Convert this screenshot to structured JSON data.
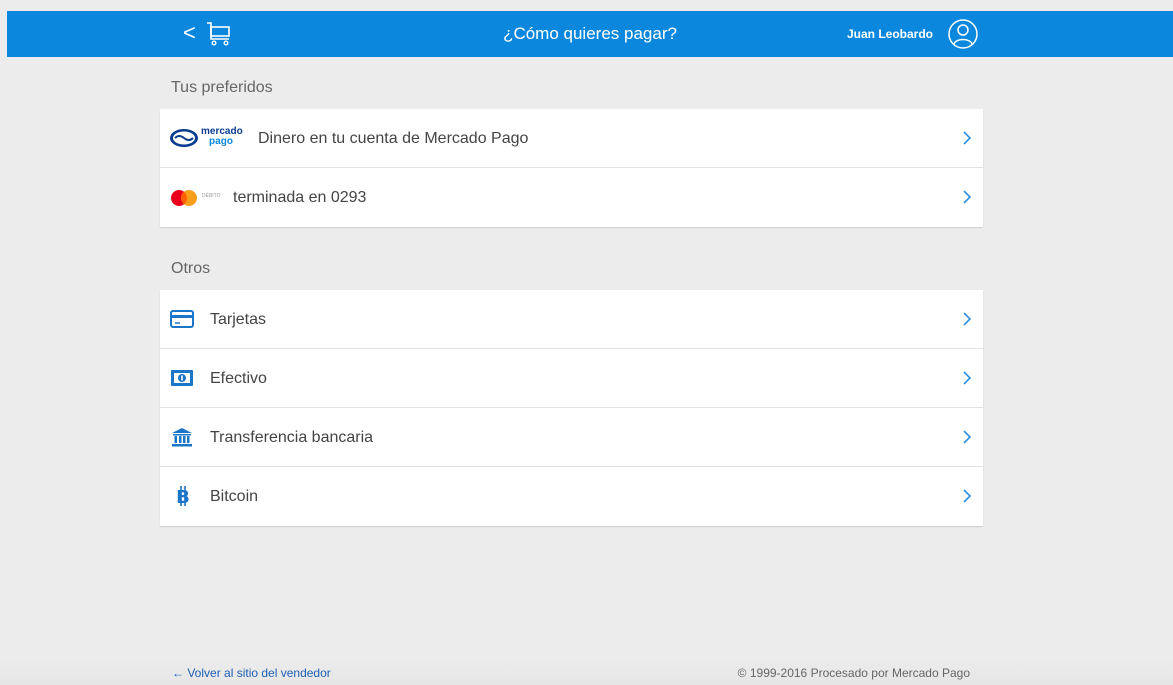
{
  "header": {
    "back_glyph": "<",
    "title": "¿Cómo quieres pagar?",
    "user_name": "Juan Leobardo"
  },
  "sections": {
    "preferred": {
      "title": "Tus preferidos",
      "items": [
        {
          "label": "Dinero en tu cuenta de Mercado Pago",
          "icon": "mercadopago-logo",
          "logo_text_top": "mercado",
          "logo_text_bottom": "pago"
        },
        {
          "label": "terminada en 0293",
          "icon": "mastercard-debit-logo",
          "logo_text": "DÉBITO"
        }
      ]
    },
    "others": {
      "title": "Otros",
      "items": [
        {
          "label": "Tarjetas",
          "icon": "credit-card-icon"
        },
        {
          "label": "Efectivo",
          "icon": "cash-icon"
        },
        {
          "label": "Transferencia bancaria",
          "icon": "bank-icon"
        },
        {
          "label": "Bitcoin",
          "icon": "bitcoin-icon"
        }
      ]
    }
  },
  "footer": {
    "back_link": "← Volver al sitio del vendedor",
    "copyright": "© 1999-2016 Procesado por Mercado Pago"
  },
  "colors": {
    "primary": "#0b87dd",
    "background": "#ececec",
    "chevron": "#2d8fe0",
    "link": "#1d5fb5"
  }
}
